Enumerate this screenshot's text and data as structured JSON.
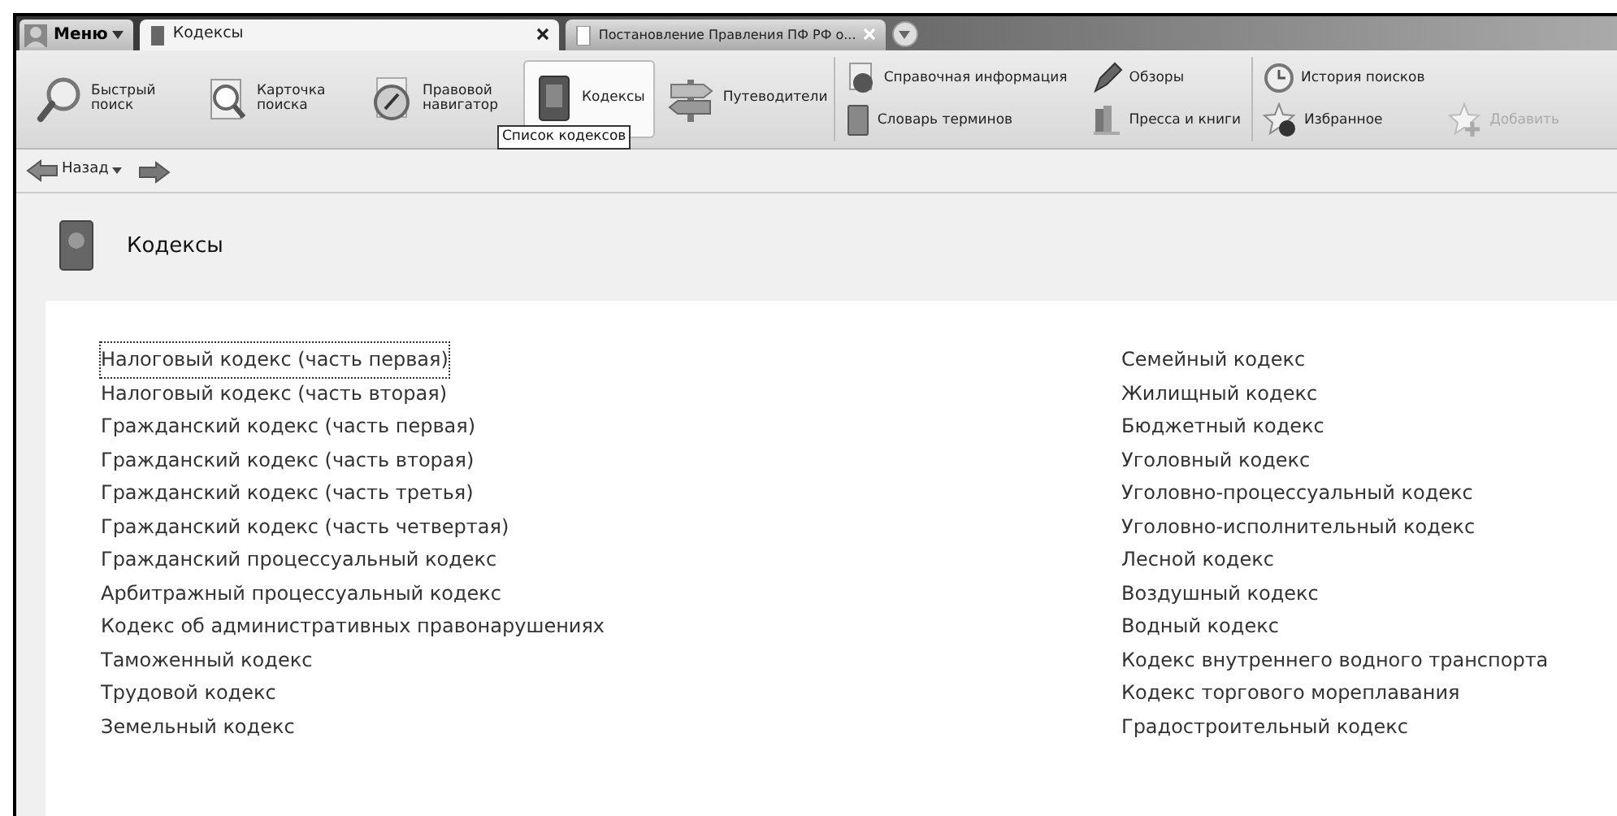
{
  "menu": {
    "label": "Меню"
  },
  "tabs": [
    {
      "label": "Кодексы",
      "selected": true
    },
    {
      "label": "Постановление Правления ПФ РФ о...",
      "selected": false
    }
  ],
  "toolbar": {
    "big_buttons": [
      {
        "label": "Быстрый поиск",
        "kind": "search",
        "selected": false
      },
      {
        "label": "Карточка поиска",
        "kind": "card",
        "selected": false
      },
      {
        "label": "Правовой навигатор",
        "kind": "compass",
        "selected": false
      },
      {
        "label": "Кодексы",
        "kind": "book",
        "selected": true
      },
      {
        "label": "Путеводители",
        "kind": "signpost",
        "selected": false
      }
    ],
    "tooltip": "Список кодексов",
    "small_buttons": [
      {
        "label": "Справочная информация",
        "kind": "info",
        "disabled": false
      },
      {
        "label": "Словарь терминов",
        "kind": "dictionary",
        "disabled": false
      },
      {
        "label": "Обзоры",
        "kind": "pen",
        "disabled": false
      },
      {
        "label": "Пресса и книги",
        "kind": "books",
        "disabled": false
      },
      {
        "label": "История поисков",
        "kind": "clock",
        "disabled": false
      },
      {
        "label": "Избранное",
        "kind": "star",
        "disabled": false
      },
      {
        "label": "Добавить",
        "kind": "star-add",
        "disabled": true
      }
    ]
  },
  "navigation": {
    "back": "Назад"
  },
  "page": {
    "title": "Кодексы"
  },
  "codes": {
    "left": [
      {
        "label": "Налоговый кодекс (часть первая)",
        "focused": true
      },
      {
        "label": "Налоговый кодекс (часть вторая)",
        "focused": false
      },
      {
        "label": "Гражданский кодекс (часть первая)",
        "focused": false
      },
      {
        "label": "Гражданский кодекс (часть вторая)",
        "focused": false
      },
      {
        "label": "Гражданский кодекс (часть третья)",
        "focused": false
      },
      {
        "label": "Гражданский кодекс (часть четвертая)",
        "focused": false
      },
      {
        "label": "Гражданский процессуальный кодекс",
        "focused": false
      },
      {
        "label": "Арбитражный процессуальный кодекс",
        "focused": false
      },
      {
        "label": "Кодекс об административных правонарушениях",
        "focused": false
      },
      {
        "label": "Таможенный кодекс",
        "focused": false
      },
      {
        "label": "Трудовой кодекс",
        "focused": false
      },
      {
        "label": "Земельный кодекс",
        "focused": false
      }
    ],
    "right": [
      {
        "label": "Семейный кодекс",
        "focused": false
      },
      {
        "label": "Жилищный кодекс",
        "focused": false
      },
      {
        "label": "Бюджетный кодекс",
        "focused": false
      },
      {
        "label": "Уголовный кодекс",
        "focused": false
      },
      {
        "label": "Уголовно-процессуальный кодекс",
        "focused": false
      },
      {
        "label": "Уголовно-исполнительный кодекс",
        "focused": false
      },
      {
        "label": "Лесной кодекс",
        "focused": false
      },
      {
        "label": "Воздушный кодекс",
        "focused": false
      },
      {
        "label": "Водный кодекс",
        "focused": false
      },
      {
        "label": "Кодекс внутреннего водного транспорта",
        "focused": false
      },
      {
        "label": "Кодекс торгового мореплавания",
        "focused": false
      },
      {
        "label": "Градостроительный кодекс",
        "focused": false
      }
    ]
  }
}
